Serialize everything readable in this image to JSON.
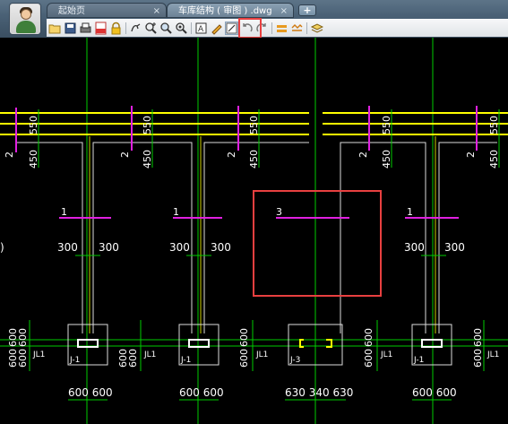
{
  "tabs": {
    "home_label": "起始页",
    "home_close": "×",
    "drawing_label": "车库结构 ( 审图 ) .dwg",
    "drawing_close": "×",
    "new_tab": "+"
  },
  "toolbar": {
    "icons": [
      "open-icon",
      "save-icon",
      "print-icon",
      "pdf-icon",
      "lock-icon",
      "pan-icon",
      "zoom-in-icon",
      "zoom-window-icon",
      "zoom-extents-icon",
      "text-icon",
      "pencil-icon",
      "measure-icon",
      "undo-icon",
      "redo-icon",
      "layer-icon",
      "hatch-icon",
      "layers-icon"
    ]
  },
  "canvas": {
    "colors": {
      "background": "#000000",
      "grid": "#00cc00",
      "beam": "#ffff00",
      "section_mark": "#e020e0",
      "outline": "#ffffff",
      "highlight": "#e84040"
    },
    "dimensions": {
      "d550": "550",
      "d450": "450",
      "d2": "2",
      "d300": "300",
      "d600": "600",
      "d630": "630",
      "d340": "340"
    },
    "sections": {
      "s1": "1",
      "s3": "3"
    },
    "footings": {
      "j1": "J-1",
      "j3": "J-3",
      "jl1": "JL1"
    },
    "bottom_dims": {
      "a": "600 600",
      "b": "630 340 630"
    },
    "partial_left": ")"
  }
}
